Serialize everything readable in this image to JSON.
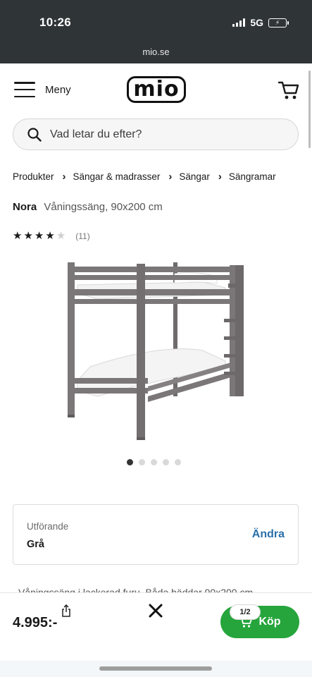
{
  "status_bar": {
    "time": "10:26",
    "network": "5G"
  },
  "browser": {
    "url": "mio.se"
  },
  "header": {
    "menu_label": "Meny",
    "logo_text": "MIO"
  },
  "search": {
    "placeholder": "Vad letar du efter?"
  },
  "breadcrumb": [
    "Produkter",
    "Sängar & madrasser",
    "Sängar",
    "Sängramar"
  ],
  "product": {
    "brand": "Nora",
    "description": "Våningssäng, 90x200 cm",
    "rating": 4,
    "rating_max": 5,
    "review_count": "(11)",
    "image_count": 5,
    "active_image": 0,
    "frame_color": "#7b7778"
  },
  "variant": {
    "label": "Utförande",
    "value": "Grå",
    "change_label": "Ändra"
  },
  "description_preview": "Våningssäng i lackerad furu. Båda bäddar 90x200 cm",
  "bottom_bar": {
    "price": "4.995:-",
    "buy_label": "Köp",
    "page_indicator": "1/2",
    "buy_color": "#26a53c"
  }
}
